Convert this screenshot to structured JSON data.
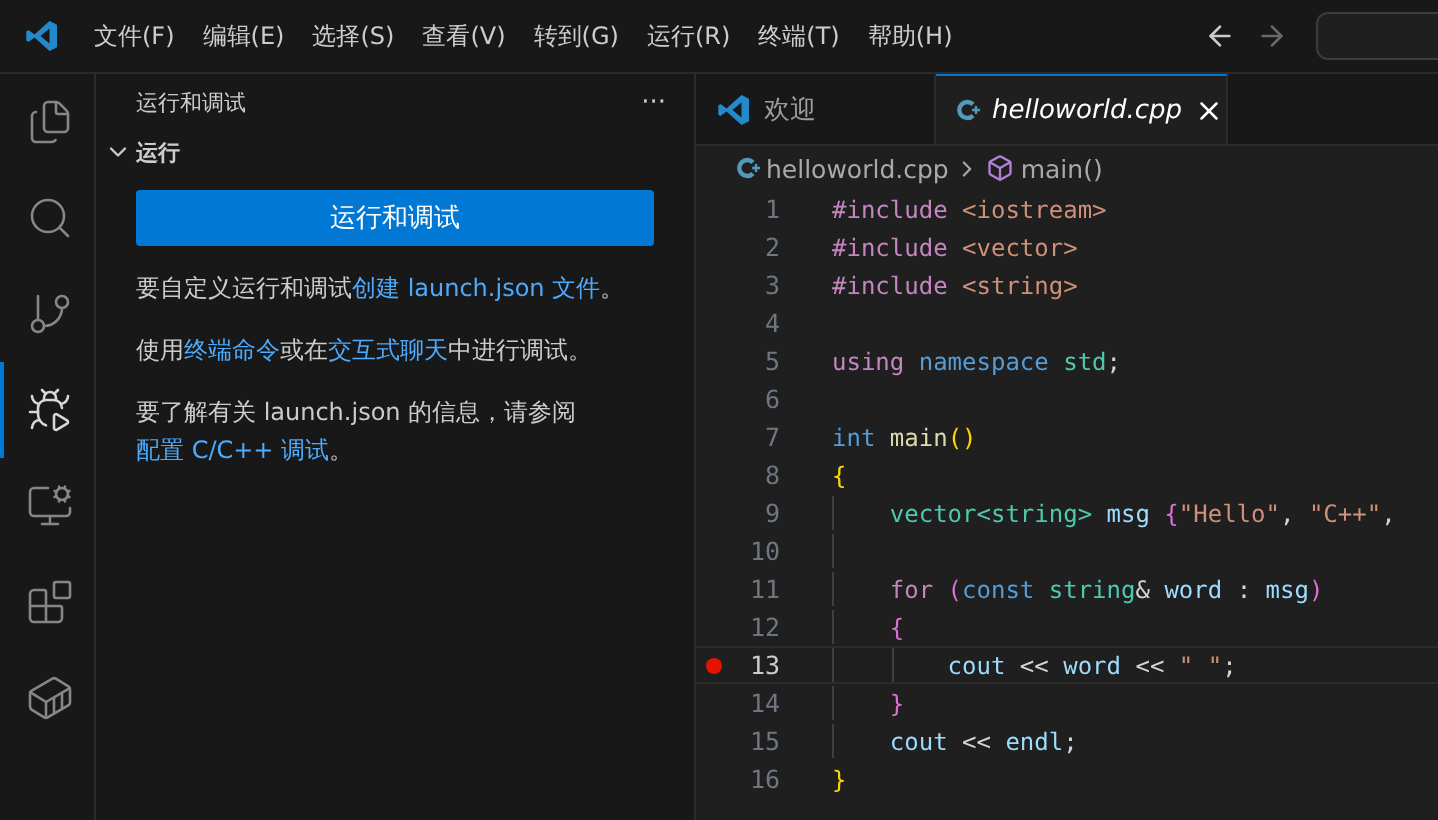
{
  "menu": [
    "文件(F)",
    "编辑(E)",
    "选择(S)",
    "查看(V)",
    "转到(G)",
    "运行(R)",
    "终端(T)",
    "帮助(H)"
  ],
  "nav": {
    "back_disabled": false,
    "forward_disabled": true
  },
  "activity": [
    {
      "kind": "files",
      "selected": false
    },
    {
      "kind": "search",
      "selected": false
    },
    {
      "kind": "source-control",
      "selected": false
    },
    {
      "kind": "run-debug",
      "selected": true
    },
    {
      "kind": "remote",
      "selected": false
    },
    {
      "kind": "extensions",
      "selected": false
    },
    {
      "kind": "containers",
      "selected": false
    }
  ],
  "sidebar": {
    "title": "运行和调试",
    "more": "···",
    "section": {
      "label": "运行",
      "expanded": true
    },
    "button": "运行和调试",
    "paragraphs": [
      [
        {
          "text": "要自定义运行和调试",
          "kind": "text"
        },
        {
          "text": "创建 launch.json 文件",
          "kind": "link"
        },
        {
          "text": "。",
          "kind": "text"
        }
      ],
      [
        {
          "text": "使用",
          "kind": "text"
        },
        {
          "text": "终端命令",
          "kind": "link"
        },
        {
          "text": "或在",
          "kind": "text"
        },
        {
          "text": "交互式聊天",
          "kind": "link"
        },
        {
          "text": "中进行调试。",
          "kind": "text"
        }
      ],
      [
        {
          "text": "要了解有关 launch.json 的信息，请参阅 ",
          "kind": "text"
        },
        {
          "text": "配置 C/C++ 调试",
          "kind": "link"
        },
        {
          "text": "。",
          "kind": "text"
        }
      ]
    ]
  },
  "tabs": [
    {
      "label": "欢迎",
      "kind": "welcome",
      "selected": false
    },
    {
      "label": "helloworld.cpp",
      "kind": "cpp",
      "selected": true
    }
  ],
  "breadcrumb": {
    "file": "helloworld.cpp",
    "symbol": "main()"
  },
  "code": [
    {
      "n": "1",
      "breakpoint": false,
      "tokens": [
        {
          "t": "#include",
          "kind": "kw"
        },
        {
          "t": " <iostream>",
          "kind": "str"
        }
      ]
    },
    {
      "n": "2",
      "breakpoint": false,
      "tokens": [
        {
          "t": "#include",
          "kind": "kw"
        },
        {
          "t": " <vector>",
          "kind": "str"
        }
      ]
    },
    {
      "n": "3",
      "breakpoint": false,
      "tokens": [
        {
          "t": "#include",
          "kind": "kw"
        },
        {
          "t": " <string>",
          "kind": "str"
        }
      ]
    },
    {
      "n": "4",
      "breakpoint": false
    },
    {
      "n": "5",
      "breakpoint": false,
      "tokens": [
        {
          "t": "using",
          "kind": "kw"
        },
        {
          "t": " namespace",
          "kind": "type"
        },
        {
          "t": " std",
          "kind": "typename"
        },
        {
          "t": ";",
          "kind": "plain"
        }
      ]
    },
    {
      "n": "6",
      "breakpoint": false
    },
    {
      "n": "7",
      "breakpoint": false,
      "tokens": [
        {
          "t": "int",
          "kind": "type"
        },
        {
          "t": " main",
          "kind": "fn"
        },
        {
          "t": "()",
          "kind": "bracket1"
        }
      ]
    },
    {
      "n": "8",
      "breakpoint": false,
      "tokens": [
        {
          "t": "{",
          "kind": "bracket1"
        }
      ]
    },
    {
      "n": "9",
      "breakpoint": false,
      "tokens": [
        {
          "t": "    vector<string>",
          "kind": "typename"
        },
        {
          "t": " msg",
          "kind": "var"
        },
        {
          "t": " {",
          "kind": "bracket2"
        },
        {
          "t": "\"Hello\"",
          "kind": "str"
        },
        {
          "t": ", ",
          "kind": "plain"
        },
        {
          "t": "\"C++\"",
          "kind": "str"
        },
        {
          "t": ",",
          "kind": "plain"
        }
      ]
    },
    {
      "n": "10",
      "breakpoint": false
    },
    {
      "n": "11",
      "breakpoint": false,
      "tokens": [
        {
          "t": "    for",
          "kind": "kw"
        },
        {
          "t": " (",
          "kind": "bracket2"
        },
        {
          "t": "const",
          "kind": "type"
        },
        {
          "t": " string",
          "kind": "typename"
        },
        {
          "t": "& ",
          "kind": "plain"
        },
        {
          "t": "word",
          "kind": "var"
        },
        {
          "t": " : ",
          "kind": "plain"
        },
        {
          "t": "msg",
          "kind": "var"
        },
        {
          "t": ")",
          "kind": "bracket2"
        }
      ]
    },
    {
      "n": "12",
      "breakpoint": false,
      "tokens": [
        {
          "t": "    {",
          "kind": "bracket2"
        }
      ]
    },
    {
      "n": "13",
      "breakpoint": true,
      "tokens": [
        {
          "t": "        cout",
          "kind": "var"
        },
        {
          "t": " << ",
          "kind": "plain"
        },
        {
          "t": "word",
          "kind": "var"
        },
        {
          "t": " << ",
          "kind": "plain"
        },
        {
          "t": "\" \"",
          "kind": "str"
        },
        {
          "t": ";",
          "kind": "plain"
        }
      ]
    },
    {
      "n": "14",
      "breakpoint": false,
      "tokens": [
        {
          "t": "    }",
          "kind": "bracket2"
        }
      ]
    },
    {
      "n": "15",
      "breakpoint": false,
      "tokens": [
        {
          "t": "    cout",
          "kind": "var"
        },
        {
          "t": " << ",
          "kind": "plain"
        },
        {
          "t": "endl",
          "kind": "var"
        },
        {
          "t": ";",
          "kind": "plain"
        }
      ]
    },
    {
      "n": "16",
      "breakpoint": false,
      "tokens": [
        {
          "t": "}",
          "kind": "bracket1"
        }
      ]
    }
  ]
}
